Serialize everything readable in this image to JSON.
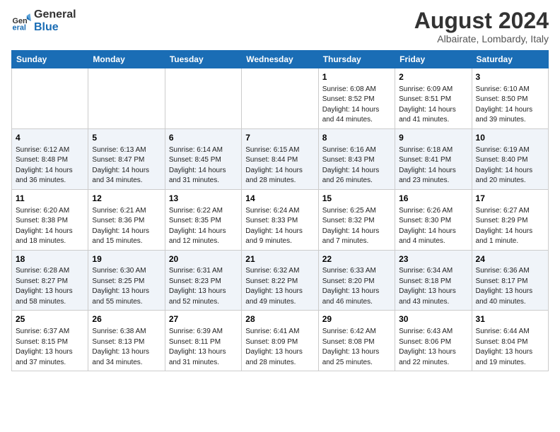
{
  "logo": {
    "line1": "General",
    "line2": "Blue"
  },
  "title": "August 2024",
  "subtitle": "Albairate, Lombardy, Italy",
  "days_of_week": [
    "Sunday",
    "Monday",
    "Tuesday",
    "Wednesday",
    "Thursday",
    "Friday",
    "Saturday"
  ],
  "weeks": [
    [
      {
        "day": "",
        "text": ""
      },
      {
        "day": "",
        "text": ""
      },
      {
        "day": "",
        "text": ""
      },
      {
        "day": "",
        "text": ""
      },
      {
        "day": "1",
        "text": "Sunrise: 6:08 AM\nSunset: 8:52 PM\nDaylight: 14 hours\nand 44 minutes."
      },
      {
        "day": "2",
        "text": "Sunrise: 6:09 AM\nSunset: 8:51 PM\nDaylight: 14 hours\nand 41 minutes."
      },
      {
        "day": "3",
        "text": "Sunrise: 6:10 AM\nSunset: 8:50 PM\nDaylight: 14 hours\nand 39 minutes."
      }
    ],
    [
      {
        "day": "4",
        "text": "Sunrise: 6:12 AM\nSunset: 8:48 PM\nDaylight: 14 hours\nand 36 minutes."
      },
      {
        "day": "5",
        "text": "Sunrise: 6:13 AM\nSunset: 8:47 PM\nDaylight: 14 hours\nand 34 minutes."
      },
      {
        "day": "6",
        "text": "Sunrise: 6:14 AM\nSunset: 8:45 PM\nDaylight: 14 hours\nand 31 minutes."
      },
      {
        "day": "7",
        "text": "Sunrise: 6:15 AM\nSunset: 8:44 PM\nDaylight: 14 hours\nand 28 minutes."
      },
      {
        "day": "8",
        "text": "Sunrise: 6:16 AM\nSunset: 8:43 PM\nDaylight: 14 hours\nand 26 minutes."
      },
      {
        "day": "9",
        "text": "Sunrise: 6:18 AM\nSunset: 8:41 PM\nDaylight: 14 hours\nand 23 minutes."
      },
      {
        "day": "10",
        "text": "Sunrise: 6:19 AM\nSunset: 8:40 PM\nDaylight: 14 hours\nand 20 minutes."
      }
    ],
    [
      {
        "day": "11",
        "text": "Sunrise: 6:20 AM\nSunset: 8:38 PM\nDaylight: 14 hours\nand 18 minutes."
      },
      {
        "day": "12",
        "text": "Sunrise: 6:21 AM\nSunset: 8:36 PM\nDaylight: 14 hours\nand 15 minutes."
      },
      {
        "day": "13",
        "text": "Sunrise: 6:22 AM\nSunset: 8:35 PM\nDaylight: 14 hours\nand 12 minutes."
      },
      {
        "day": "14",
        "text": "Sunrise: 6:24 AM\nSunset: 8:33 PM\nDaylight: 14 hours\nand 9 minutes."
      },
      {
        "day": "15",
        "text": "Sunrise: 6:25 AM\nSunset: 8:32 PM\nDaylight: 14 hours\nand 7 minutes."
      },
      {
        "day": "16",
        "text": "Sunrise: 6:26 AM\nSunset: 8:30 PM\nDaylight: 14 hours\nand 4 minutes."
      },
      {
        "day": "17",
        "text": "Sunrise: 6:27 AM\nSunset: 8:29 PM\nDaylight: 14 hours\nand 1 minute."
      }
    ],
    [
      {
        "day": "18",
        "text": "Sunrise: 6:28 AM\nSunset: 8:27 PM\nDaylight: 13 hours\nand 58 minutes."
      },
      {
        "day": "19",
        "text": "Sunrise: 6:30 AM\nSunset: 8:25 PM\nDaylight: 13 hours\nand 55 minutes."
      },
      {
        "day": "20",
        "text": "Sunrise: 6:31 AM\nSunset: 8:23 PM\nDaylight: 13 hours\nand 52 minutes."
      },
      {
        "day": "21",
        "text": "Sunrise: 6:32 AM\nSunset: 8:22 PM\nDaylight: 13 hours\nand 49 minutes."
      },
      {
        "day": "22",
        "text": "Sunrise: 6:33 AM\nSunset: 8:20 PM\nDaylight: 13 hours\nand 46 minutes."
      },
      {
        "day": "23",
        "text": "Sunrise: 6:34 AM\nSunset: 8:18 PM\nDaylight: 13 hours\nand 43 minutes."
      },
      {
        "day": "24",
        "text": "Sunrise: 6:36 AM\nSunset: 8:17 PM\nDaylight: 13 hours\nand 40 minutes."
      }
    ],
    [
      {
        "day": "25",
        "text": "Sunrise: 6:37 AM\nSunset: 8:15 PM\nDaylight: 13 hours\nand 37 minutes."
      },
      {
        "day": "26",
        "text": "Sunrise: 6:38 AM\nSunset: 8:13 PM\nDaylight: 13 hours\nand 34 minutes."
      },
      {
        "day": "27",
        "text": "Sunrise: 6:39 AM\nSunset: 8:11 PM\nDaylight: 13 hours\nand 31 minutes."
      },
      {
        "day": "28",
        "text": "Sunrise: 6:41 AM\nSunset: 8:09 PM\nDaylight: 13 hours\nand 28 minutes."
      },
      {
        "day": "29",
        "text": "Sunrise: 6:42 AM\nSunset: 8:08 PM\nDaylight: 13 hours\nand 25 minutes."
      },
      {
        "day": "30",
        "text": "Sunrise: 6:43 AM\nSunset: 8:06 PM\nDaylight: 13 hours\nand 22 minutes."
      },
      {
        "day": "31",
        "text": "Sunrise: 6:44 AM\nSunset: 8:04 PM\nDaylight: 13 hours\nand 19 minutes."
      }
    ]
  ]
}
